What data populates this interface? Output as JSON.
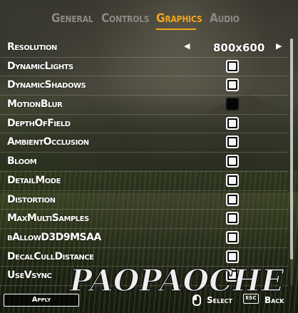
{
  "tabs": [
    {
      "label": "General",
      "active": false
    },
    {
      "label": "Controls",
      "active": false
    },
    {
      "label": "Graphics",
      "active": true
    },
    {
      "label": "Audio",
      "active": false
    }
  ],
  "resolution": {
    "label": "Resolution",
    "value": "800x600",
    "prev_icon": "triangle-left-icon",
    "next_icon": "triangle-right-icon"
  },
  "settings": [
    {
      "label": "DynamicLights",
      "checked": true
    },
    {
      "label": "DynamicShadows",
      "checked": true
    },
    {
      "label": "MotionBlur",
      "checked": false
    },
    {
      "label": "DepthOfField",
      "checked": true
    },
    {
      "label": "AmbientOcclusion",
      "checked": true
    },
    {
      "label": "Bloom",
      "checked": true
    },
    {
      "label": "DetailMode",
      "checked": true
    },
    {
      "label": "Distortion",
      "checked": true
    },
    {
      "label": "MaxMultiSamples",
      "checked": true
    },
    {
      "label": "bAllowD3D9MSAA",
      "checked": true
    },
    {
      "label": "DecalCullDistance",
      "checked": true
    },
    {
      "label": "UseVsync",
      "checked": true
    }
  ],
  "footer": {
    "apply_label": "Apply",
    "select_label": "Select",
    "esc_key": "ESC",
    "back_label": "Back"
  },
  "watermark": "PAOPAOCHE",
  "colors": {
    "accent": "#f0a51e",
    "text": "#ffffff",
    "inactive_tab": "#8b8a84"
  }
}
